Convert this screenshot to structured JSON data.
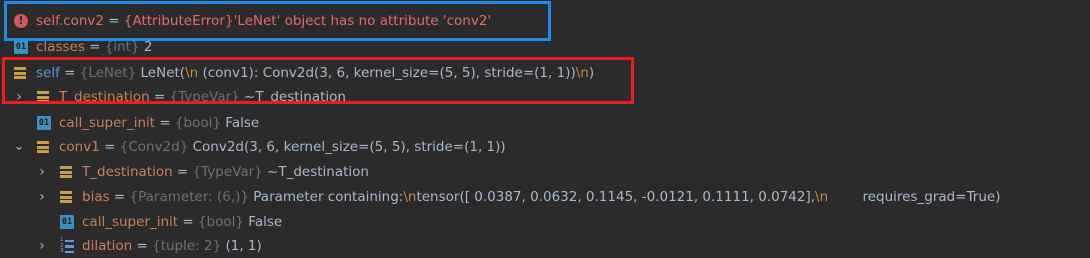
{
  "rows": [
    {
      "name": "self.conv2",
      "eq": " = ",
      "error": "{AttributeError}'LeNet' object has no attribute 'conv2'"
    },
    {
      "name": "classes",
      "eq": " = ",
      "type": "{int}",
      "value": " 2"
    },
    {
      "name": "self",
      "eq": " = ",
      "type": "{LeNet}",
      "value_a": " LeNet(",
      "esc_a": "\\n",
      "value_b": "  (conv1): Conv2d(3, 6, kernel_size=(5, 5), stride=(1, 1))",
      "esc_b": "\\n",
      "value_c": ")"
    },
    {
      "name": "T_destination",
      "eq": " = ",
      "type": "{TypeVar}",
      "value": " ~T_destination"
    },
    {
      "name": "call_super_init",
      "eq": " = ",
      "type": "{bool}",
      "value": " False"
    },
    {
      "name": "conv1",
      "eq": " = ",
      "type": "{Conv2d}",
      "value": " Conv2d(3, 6, kernel_size=(5, 5), stride=(1, 1))"
    },
    {
      "name": "T_destination",
      "eq": " = ",
      "type": "{TypeVar}",
      "value": " ~T_destination"
    },
    {
      "name": "bias",
      "eq": " = ",
      "type": "{Parameter: (6,)}",
      "value_a": " Parameter containing:",
      "esc_a": "\\n",
      "value_b": "tensor([ 0.0387,  0.0632,  0.1145, -0.0121,  0.1111,  0.0742],",
      "esc_b": "\\n",
      "value_c": "        requires_grad=True)"
    },
    {
      "name": "call_super_init",
      "eq": " = ",
      "type": "{bool}",
      "value": " False"
    },
    {
      "name": "dilation",
      "eq": " = ",
      "type": "{tuple: 2}",
      "value": " (1, 1)"
    }
  ],
  "icons": {
    "prim_label": "01",
    "error_glyph": "!",
    "list_numbers": [
      "1",
      "2",
      "3"
    ],
    "expand_glyph": "›",
    "collapse_glyph": "⌄"
  },
  "colors": {
    "background": "#2b2b2b",
    "error": "#e06c6c",
    "annotation_blue": "#1f8be8",
    "annotation_red": "#ee1c1c"
  }
}
